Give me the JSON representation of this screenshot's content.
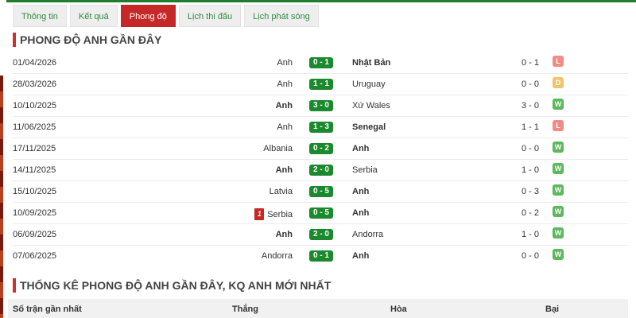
{
  "tabs": [
    {
      "label": "Thông tin",
      "active": false
    },
    {
      "label": "Kết quả",
      "active": false
    },
    {
      "label": "Phong độ",
      "active": true
    },
    {
      "label": "Lịch thi đấu",
      "active": false
    },
    {
      "label": "Lịch phát sóng",
      "active": false
    }
  ],
  "section1_title": "PHONG ĐỘ ANH GẦN ĐÂY",
  "matches": [
    {
      "date": "01/04/2026",
      "home": "Anh",
      "score": "0 - 1",
      "away": "Nhật Bản",
      "ht": "0 - 1",
      "result": "L",
      "bold": "away",
      "red_card": ""
    },
    {
      "date": "28/03/2026",
      "home": "Anh",
      "score": "1 - 1",
      "away": "Uruguay",
      "ht": "0 - 0",
      "result": "D",
      "bold": "",
      "red_card": ""
    },
    {
      "date": "10/10/2025",
      "home": "Anh",
      "score": "3 - 0",
      "away": "Xứ Wales",
      "ht": "3 - 0",
      "result": "W",
      "bold": "home",
      "red_card": ""
    },
    {
      "date": "11/06/2025",
      "home": "Anh",
      "score": "1 - 3",
      "away": "Senegal",
      "ht": "1 - 1",
      "result": "L",
      "bold": "away",
      "red_card": ""
    },
    {
      "date": "17/11/2025",
      "home": "Albania",
      "score": "0 - 2",
      "away": "Anh",
      "ht": "0 - 0",
      "result": "W",
      "bold": "away",
      "red_card": ""
    },
    {
      "date": "14/11/2025",
      "home": "Anh",
      "score": "2 - 0",
      "away": "Serbia",
      "ht": "1 - 0",
      "result": "W",
      "bold": "home",
      "red_card": ""
    },
    {
      "date": "15/10/2025",
      "home": "Latvia",
      "score": "0 - 5",
      "away": "Anh",
      "ht": "0 - 3",
      "result": "W",
      "bold": "away",
      "red_card": ""
    },
    {
      "date": "10/09/2025",
      "home": "Serbia",
      "score": "0 - 5",
      "away": "Anh",
      "ht": "0 - 2",
      "result": "W",
      "bold": "away",
      "red_card": "1"
    },
    {
      "date": "06/09/2025",
      "home": "Anh",
      "score": "2 - 0",
      "away": "Andorra",
      "ht": "1 - 0",
      "result": "W",
      "bold": "home",
      "red_card": ""
    },
    {
      "date": "07/06/2025",
      "home": "Andorra",
      "score": "0 - 1",
      "away": "Anh",
      "ht": "0 - 0",
      "result": "W",
      "bold": "away",
      "red_card": ""
    }
  ],
  "section2_title": "THỐNG KÊ PHONG ĐỘ ANH GẦN ĐÂY, KQ ANH MỚI NHẤT",
  "stats_headers": [
    "Số trận gần nhất",
    "Thắng",
    "Hòa",
    "Bại"
  ],
  "colors": {
    "accent": "#c62828",
    "score_bg": "#1b8a2e",
    "win": "#5cb85c",
    "loss": "#ef8c85",
    "draw": "#f0c36d",
    "tab_text": "#2e8b3c"
  }
}
